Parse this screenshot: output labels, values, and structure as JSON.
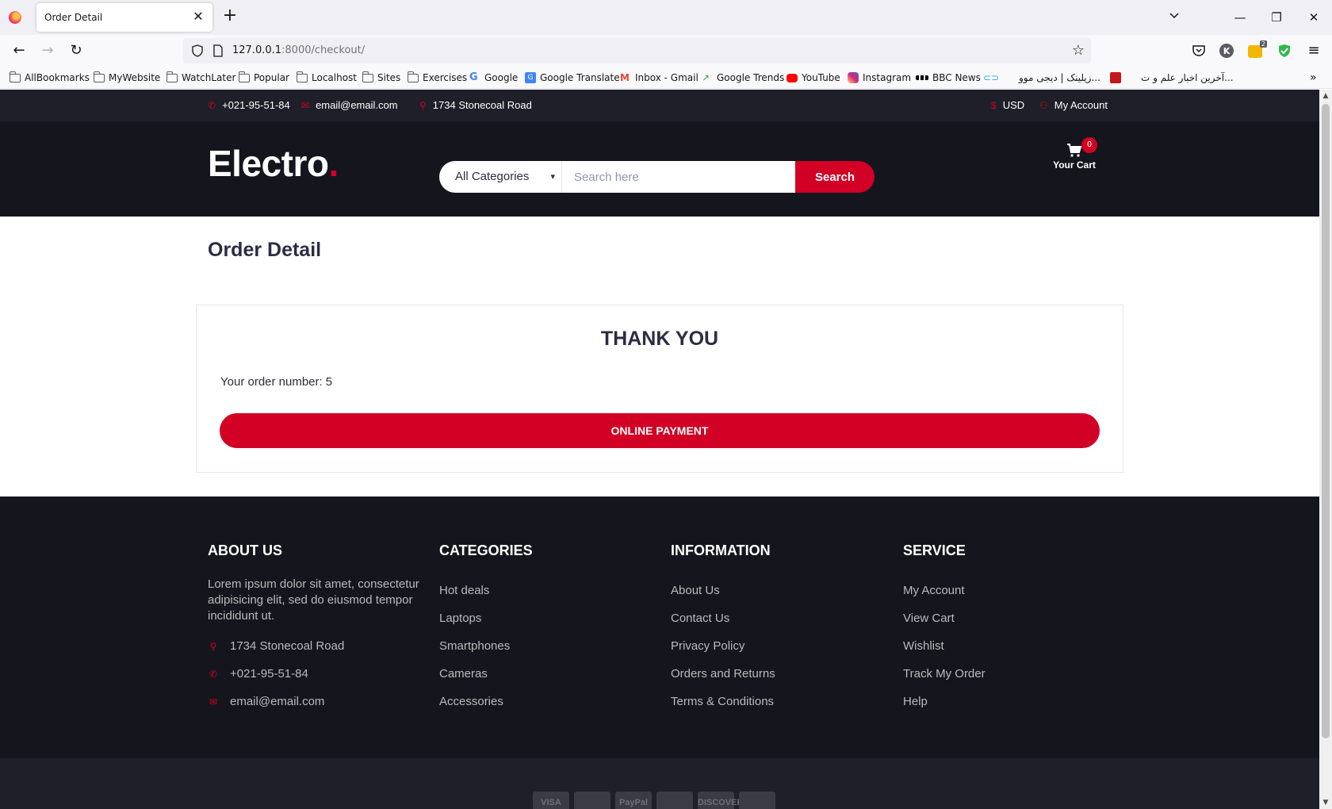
{
  "browser": {
    "tab_title": "Order Detail",
    "url_host": "127.0.0.1",
    "url_rest": ":8000/checkout/",
    "extension_badge": "2"
  },
  "bookmarks": [
    {
      "label": "AllBookmarks",
      "icon": "folder-icon"
    },
    {
      "label": "MyWebsite",
      "icon": "folder-icon"
    },
    {
      "label": "WatchLater",
      "icon": "folder-icon"
    },
    {
      "label": "Popular",
      "icon": "folder-icon"
    },
    {
      "label": "Localhost",
      "icon": "folder-icon"
    },
    {
      "label": "Sites",
      "icon": "folder-icon"
    },
    {
      "label": "Exercises",
      "icon": "folder-icon"
    },
    {
      "label": "Google",
      "icon": "google-icon"
    },
    {
      "label": "Google Translate",
      "icon": "google-translate-icon"
    },
    {
      "label": "Inbox - Gmail",
      "icon": "gmail-icon"
    },
    {
      "label": "Google Trends",
      "icon": "google-trends-icon"
    },
    {
      "label": "YouTube",
      "icon": "youtube-icon"
    },
    {
      "label": "Instagram",
      "icon": "instagram-icon"
    },
    {
      "label": "BBC News",
      "icon": "bbc-icon"
    },
    {
      "label": "زیلینک | دیجی موو...",
      "icon": "link-icon"
    },
    {
      "label": "آخرین اخبار علم و ت...",
      "icon": "news-icon"
    }
  ],
  "top_header": {
    "phone": "+021-95-51-84",
    "email": "email@email.com",
    "address": "1734 Stonecoal Road",
    "currency": "USD",
    "account": "My Account"
  },
  "header": {
    "logo_text": "Electro",
    "logo_dot": ".",
    "category_selected": "All Categories",
    "search_placeholder": "Search here",
    "search_button": "Search",
    "cart_label": "Your Cart",
    "cart_qty": "0"
  },
  "main": {
    "page_title": "Order Detail",
    "thank_you": "THANK YOU",
    "order_number_label": "Your order number:",
    "order_number": "5",
    "payment_button": "ONLINE PAYMENT"
  },
  "footer": {
    "about": {
      "title": "ABOUT US",
      "text": "Lorem ipsum dolor sit amet, consectetur adipisicing elit, sed do eiusmod tempor incididunt ut.",
      "address": "1734 Stonecoal Road",
      "phone": "+021-95-51-84",
      "email": "email@email.com"
    },
    "categories": {
      "title": "CATEGORIES",
      "links": [
        "Hot deals",
        "Laptops",
        "Smartphones",
        "Cameras",
        "Accessories"
      ]
    },
    "information": {
      "title": "INFORMATION",
      "links": [
        "About Us",
        "Contact Us",
        "Privacy Policy",
        "Orders and Returns",
        "Terms & Conditions"
      ]
    },
    "service": {
      "title": "SERVICE",
      "links": [
        "My Account",
        "View Cart",
        "Wishlist",
        "Track My Order",
        "Help"
      ]
    }
  },
  "payment_methods": [
    "VISA",
    "",
    "PayPal",
    "",
    "DISCOVER",
    ""
  ],
  "colors": {
    "accent": "#d10024",
    "header_dark": "#15161d",
    "top_header": "#1e1f29",
    "text_dark": "#2b2d42"
  }
}
